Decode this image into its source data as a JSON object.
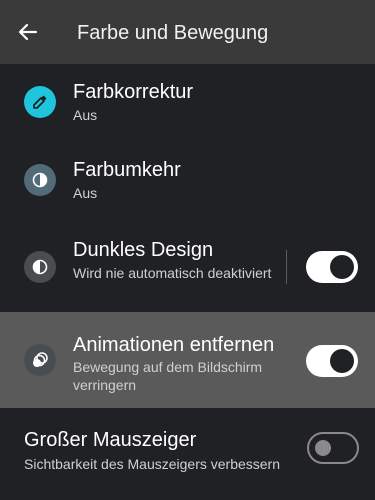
{
  "header": {
    "title": "Farbe und Bewegung"
  },
  "items": [
    {
      "title": "Farbkorrektur",
      "subtitle": "Aus",
      "icon": "eyedropper-icon"
    },
    {
      "title": "Farbumkehr",
      "subtitle": "Aus",
      "icon": "color-inversion-icon"
    },
    {
      "title": "Dunkles Design",
      "subtitle": "Wird nie automatisch deaktiviert",
      "icon": "dark-theme-icon",
      "toggle": true
    },
    {
      "title": "Animationen entfernen",
      "subtitle": "Bewegung auf dem Bildschirm verringern",
      "icon": "animation-icon",
      "toggle": true
    },
    {
      "title": "Großer Mauszeiger",
      "subtitle": "Sichtbarkeit des Mauszeigers verbessern",
      "toggle": false
    }
  ],
  "colors": {
    "accent_cyan": "#1ec5dc",
    "icon_gray": "#536a78",
    "highlight": "#5a5a5a"
  }
}
